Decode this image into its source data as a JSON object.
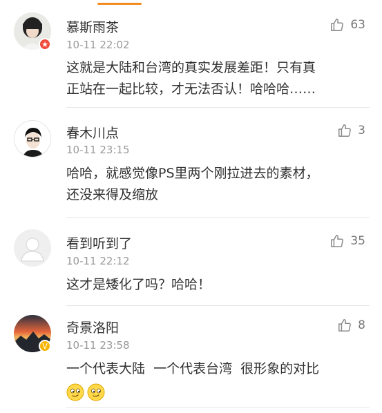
{
  "colors": {
    "accent": "#f28c21",
    "name_text": "#333333",
    "time_text": "#999999",
    "badge_red": "#f04b3a",
    "badge_gold": "#f7b500"
  },
  "comments": [
    {
      "username": "慕斯雨茶",
      "time": "10-11 22:02",
      "lines": [
        "这就是大陆和台湾的真实发展差距！只有真",
        "正站在一起比较，才无法否认！哈哈哈……"
      ],
      "likes": "63",
      "avatar": "woman-photo",
      "badge": "red-star-badge"
    },
    {
      "username": "春木川点",
      "time": "10-11 23:15",
      "lines": [
        "哈哈，就感觉像PS里两个刚拉进去的素材，",
        "还没来得及缩放"
      ],
      "likes": "3",
      "avatar": "cartoon-man"
    },
    {
      "username": "看到听到了",
      "time": "10-11 22:12",
      "lines": [
        "这才是矮化了吗？哈哈！"
      ],
      "likes": "35",
      "avatar": "default-person"
    },
    {
      "username": "奇景洛阳",
      "time": "10-11 23:58",
      "lines": [
        "一个代表大陆  一个代表台湾  很形象的对比"
      ],
      "likes": "8",
      "avatar": "sunset-mountain",
      "badge": "gold-v-badge",
      "emojis": [
        "smirk-emoji",
        "smirk-emoji"
      ]
    }
  ]
}
